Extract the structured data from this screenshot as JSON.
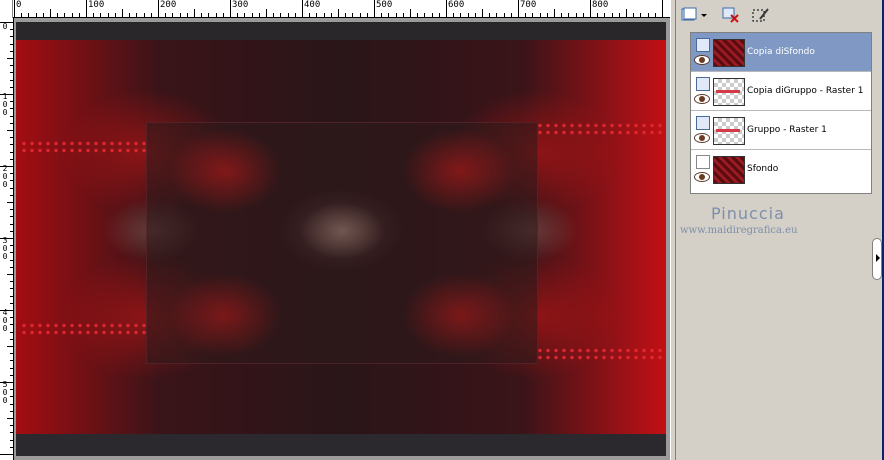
{
  "ruler": {
    "labels": [
      "0",
      "100",
      "200",
      "300",
      "400",
      "500",
      "600",
      "700",
      "800"
    ],
    "left_labels": [
      "0",
      "1\n0\n0",
      "2\n0\n0",
      "3\n0\n0",
      "4\n0\n0",
      "5\n0\n0"
    ]
  },
  "layers_panel": {
    "toolbar": {
      "new_layer_icon": "new-raster-layer-icon",
      "delete_icon": "delete-layer-icon",
      "edit_icon": "edit-selection-icon"
    },
    "layers": [
      {
        "name": "Copia diSfondo",
        "thumb": "red",
        "selected": true
      },
      {
        "name": "Copia diGruppo - Raster 1",
        "thumb": "checker",
        "selected": false
      },
      {
        "name": "Gruppo - Raster 1",
        "thumb": "checker",
        "selected": false
      },
      {
        "name": "Sfondo",
        "thumb": "red",
        "selected": false
      }
    ],
    "watermark_name": "Pinuccia",
    "watermark_url": "www.maidiregrafica.eu"
  },
  "colors": {
    "selected_layer": "#7f99c4",
    "image_red": "#c21015",
    "image_dark": "#2a1518"
  }
}
